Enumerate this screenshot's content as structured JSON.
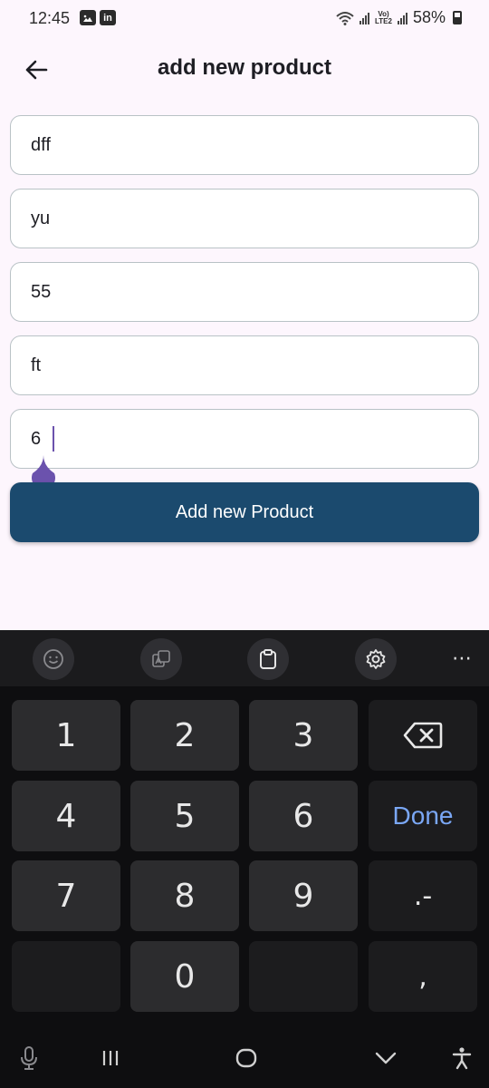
{
  "status_bar": {
    "time": "12:45",
    "battery": "58%",
    "network": "LTE2"
  },
  "app_bar": {
    "title": "add new product"
  },
  "form": {
    "fields": [
      {
        "value": "dff"
      },
      {
        "value": "yu"
      },
      {
        "value": "55"
      },
      {
        "value": "ft"
      },
      {
        "value": "6"
      }
    ],
    "submit_label": "Add new Product"
  },
  "keyboard": {
    "keys": {
      "k1": "1",
      "k2": "2",
      "k3": "3",
      "k4": "4",
      "k5": "5",
      "k6": "6",
      "k7": "7",
      "k8": "8",
      "k9": "9",
      "k0": "0",
      "done": "Done",
      "dot_dash": ".-",
      "comma": ","
    }
  },
  "colors": {
    "accent_button": "#1b4a6e",
    "cursor": "#6b52ad",
    "done_key": "#7aa7f5"
  }
}
